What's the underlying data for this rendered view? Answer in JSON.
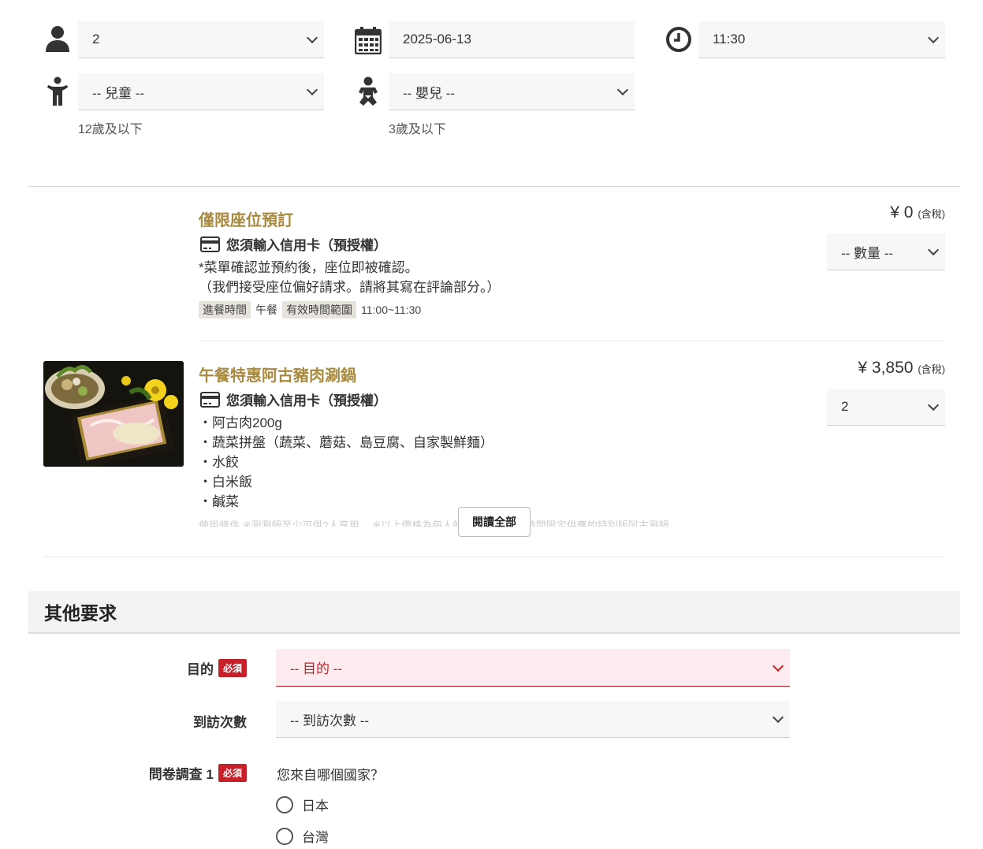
{
  "booking": {
    "party_size": "2",
    "date": "2025-06-13",
    "time": "11:30",
    "children_placeholder": "-- 兒童 --",
    "children_hint": "12歲及以下",
    "infants_placeholder": "-- 嬰兒 --",
    "infants_hint": "3歲及以下"
  },
  "items": [
    {
      "title": "僅限座位預訂",
      "credit_card_note": "您須輸入信用卡（預授權）",
      "description": [
        "*菜單確認並預約後，座位即被確認。",
        "（我們接受座位偏好請求。請將其寫在評論部分。）"
      ],
      "tag1_label": "進餐時間",
      "tag1_value": "午餐",
      "tag2_label": "有效時間範圍",
      "tag2_value": "11:00~11:30",
      "price": "¥ 0",
      "tax": "(含稅)",
      "quantity": "-- 數量 --"
    },
    {
      "title": "午餐特惠阿古豬肉涮鍋",
      "credit_card_note": "您須輸入信用卡（預授權）",
      "description": [
        "・阿古肉200g",
        "・蔬菜拼盤（蔬菜、蘑菇、島豆腐、自家製鮮麵）",
        "・水餃",
        "・白米飯",
        "・鹹菜"
      ],
      "faded_text": "使用條件 ※涮涮鍋至少可供2人享用。 ※以上價格為每人的價格。 ※午餐時間限定供應的特別版阿古涮鍋，",
      "read_all": "閱讀全部",
      "price": "¥ 3,850",
      "tax": "(含稅)",
      "quantity": "2"
    }
  ],
  "other_requests": {
    "heading": "其他要求",
    "required_badge": "必須",
    "purpose_label": "目的",
    "purpose_placeholder": "-- 目的 --",
    "visits_label": "到訪次數",
    "visits_placeholder": "-- 到訪次數 --",
    "survey_label": "問卷調查 1",
    "survey_question": "您來自哪個國家？",
    "survey_options": [
      "日本",
      "台灣"
    ]
  },
  "colors": {
    "accent_gold": "#a8893e",
    "required_red": "#c8202a"
  }
}
